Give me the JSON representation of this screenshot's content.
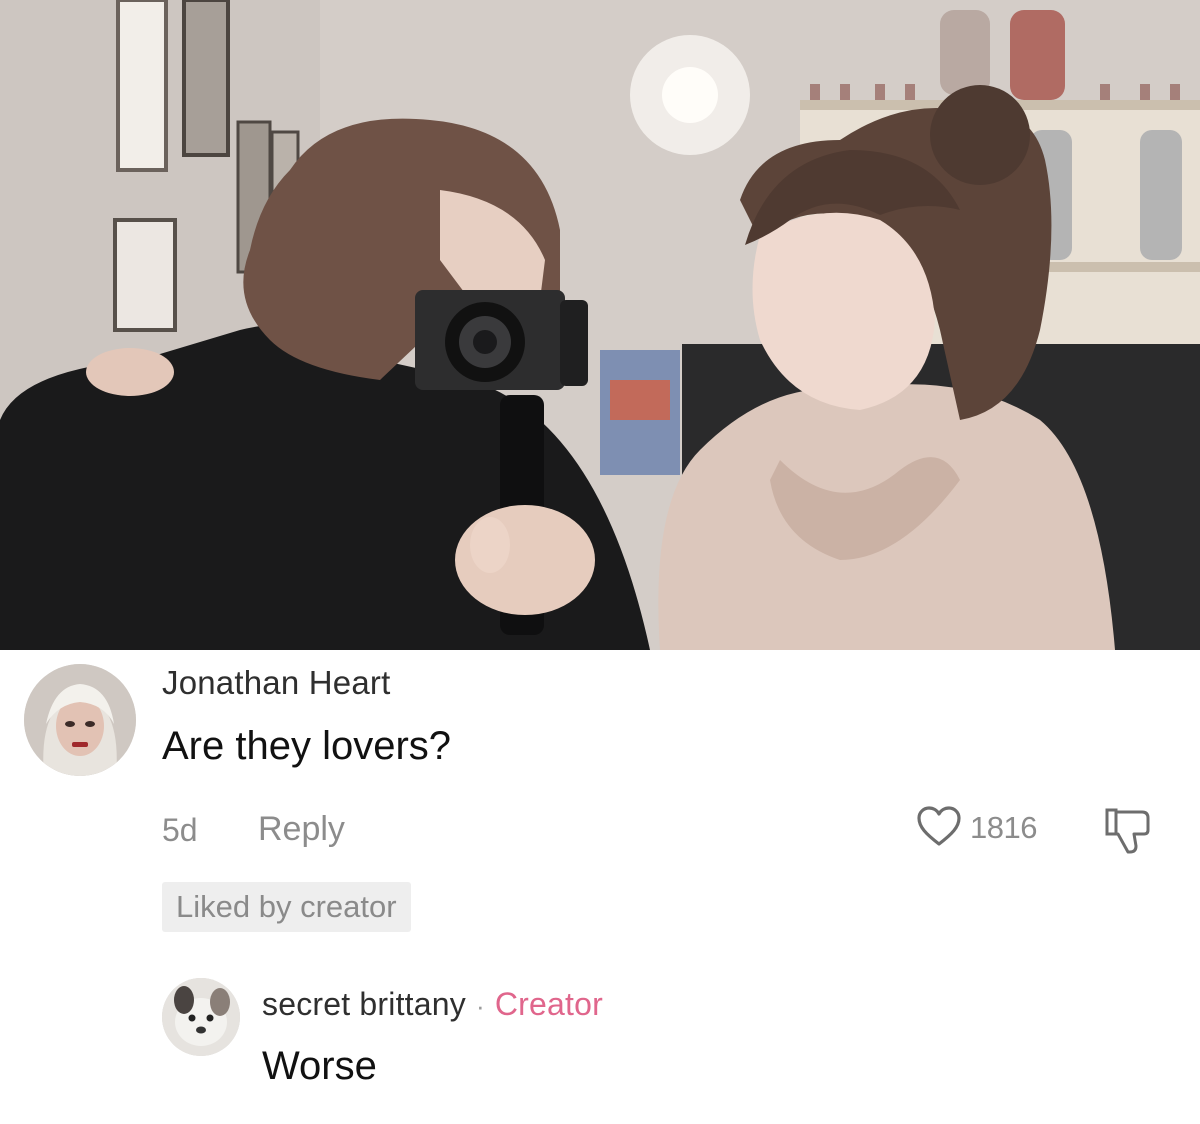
{
  "comments": [
    {
      "author": "Jonathan Heart",
      "text": "Are they lovers?",
      "time": "5d",
      "reply_label": "Reply",
      "liked_badge": "Liked by creator",
      "like_count": "1816"
    },
    {
      "author": "secret brittany",
      "separator": "·",
      "creator_label": "Creator",
      "text": "Worse"
    }
  ],
  "icons": {
    "like": "heart-outline-icon",
    "dislike": "thumbs-down-outline-icon"
  },
  "colors": {
    "author_text": "#2f2f2f",
    "meta_text": "#8c8c8c",
    "creator_tag": "#e0668c",
    "badge_bg": "#eeeeee"
  }
}
